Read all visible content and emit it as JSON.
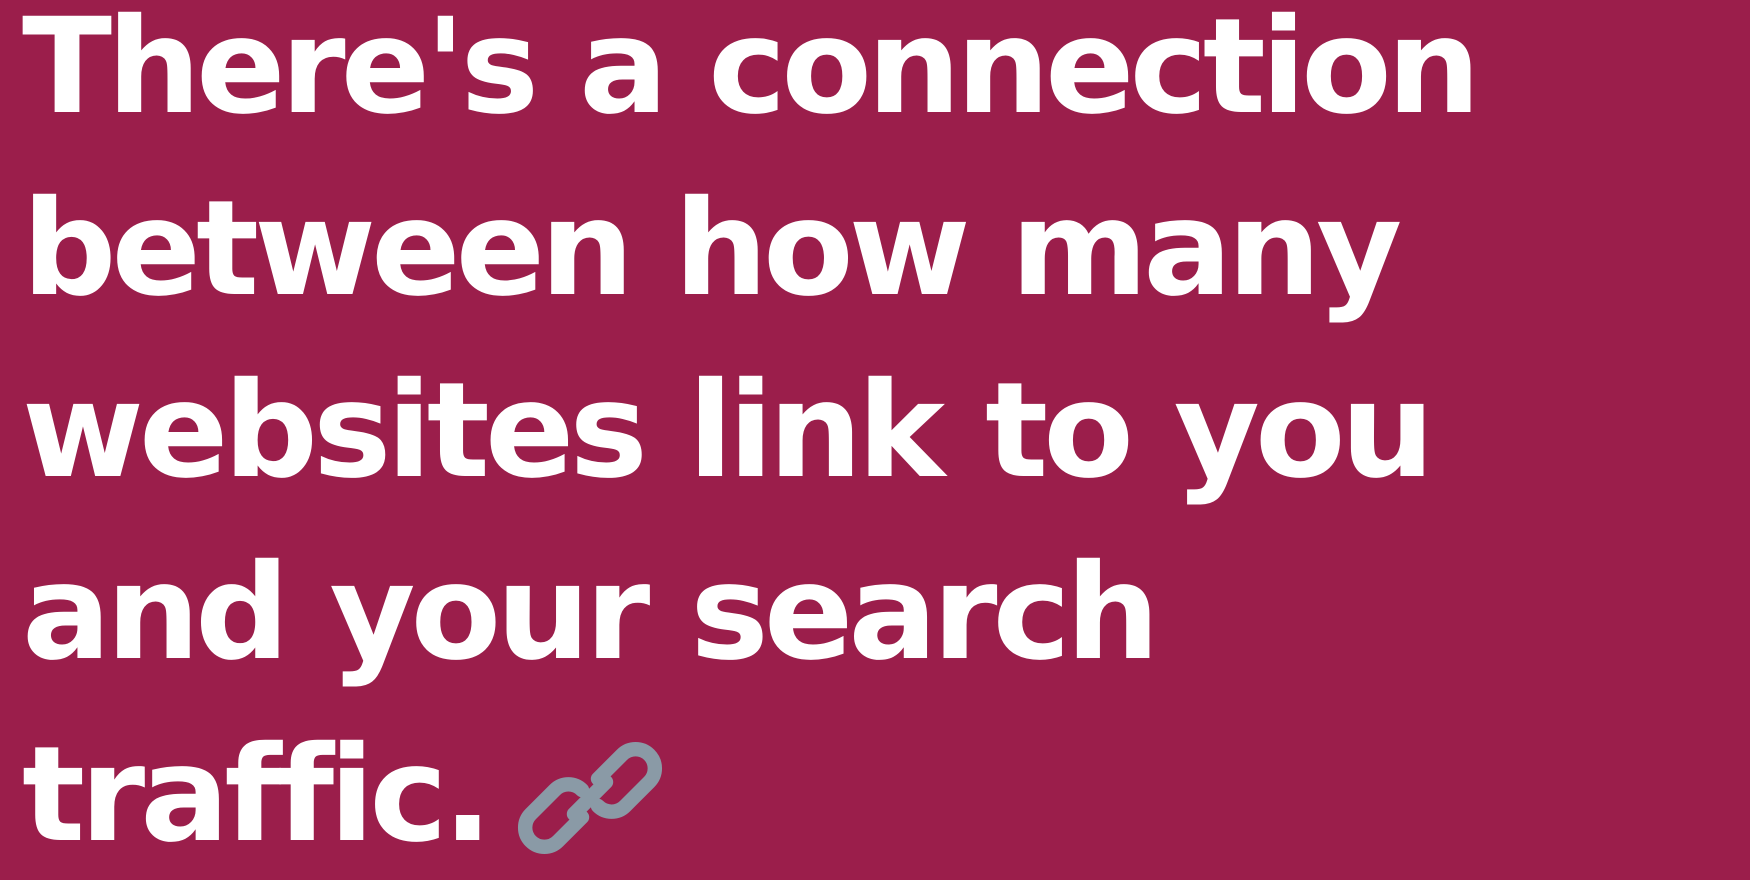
{
  "headline": {
    "lines": [
      "There's a connection",
      "between how many",
      "websites link to you",
      "and your search",
      "traffic."
    ]
  },
  "icon": {
    "name": "link-icon",
    "color": "#8a9aa6"
  },
  "colors": {
    "background": "#9b1e4b",
    "text": "#ffffff"
  }
}
